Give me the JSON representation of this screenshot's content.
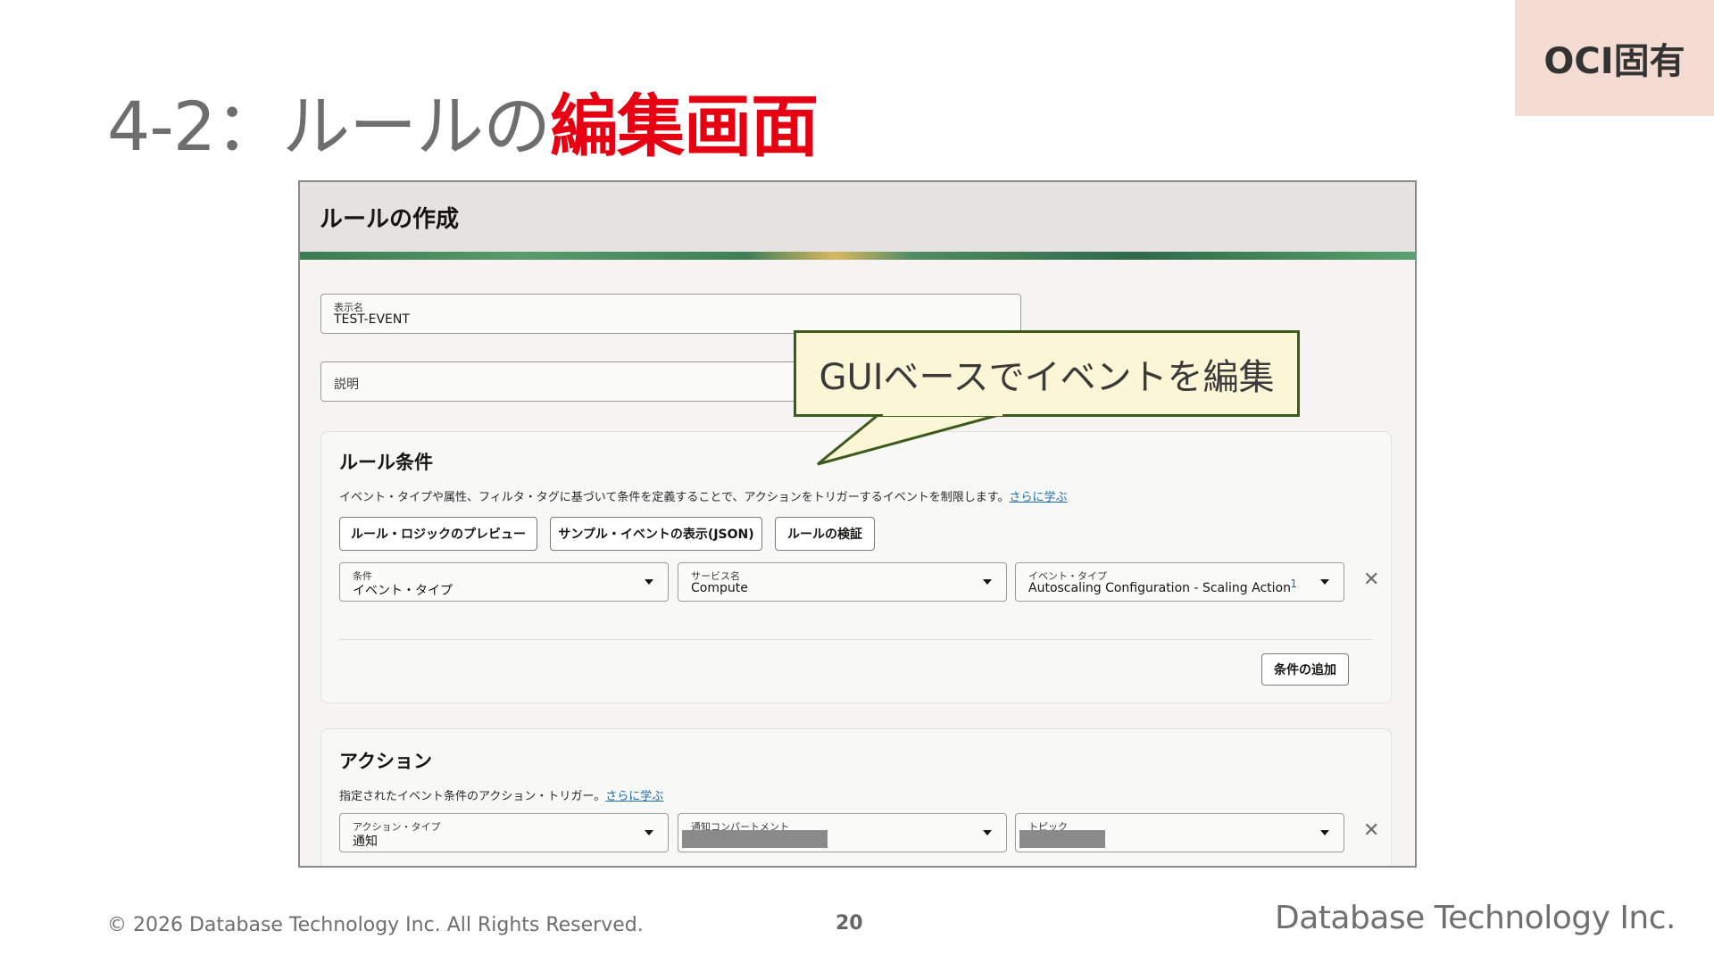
{
  "slide": {
    "badge": "OCI固有",
    "title_plain": "4-2：ルールの",
    "title_highlight": "編集画面",
    "copyright": "© 2026 Database Technology Inc. All Rights Reserved.",
    "page_number": "20",
    "company_logo": "Database Technology Inc."
  },
  "callout": {
    "text": "GUIベースでイベントを編集"
  },
  "dialog": {
    "title": "ルールの作成",
    "display_name": {
      "label": "表示名",
      "value": "TEST-EVENT"
    },
    "description": {
      "label": "説明",
      "value": ""
    },
    "rule_conditions": {
      "heading": "ルール条件",
      "description": "イベント・タイプや属性、フィルタ・タグに基づいて条件を定義することで、アクションをトリガーするイベントを制限します。",
      "learn_more": "さらに学ぶ",
      "buttons": {
        "preview": "ルール・ロジックのプレビュー",
        "sample": "サンプル・イベントの表示(JSON)",
        "validate": "ルールの検証"
      },
      "condition": {
        "label": "条件",
        "value": "イベント・タイプ"
      },
      "service_name": {
        "label": "サービス名",
        "value": "Compute"
      },
      "event_type": {
        "label": "イベント・タイプ",
        "value": "Autoscaling Configuration - Scaling Action",
        "count": "1"
      },
      "add_condition": "条件の追加"
    },
    "actions": {
      "heading": "アクション",
      "description": "指定されたイベント条件のアクション・トリガー。",
      "learn_more": "さらに学ぶ",
      "action_type": {
        "label": "アクション・タイプ",
        "value": "通知"
      },
      "notification_compartment": {
        "label": "通知コンパートメント",
        "value": ""
      },
      "topic": {
        "label": "トピック",
        "value": ""
      }
    }
  },
  "colors": {
    "title_highlight": "#e60012",
    "badge_bg": "#f4dcd2",
    "callout_bg": "#fbf6d6",
    "callout_border": "#3c5a1c",
    "link": "#1c6ca8"
  }
}
